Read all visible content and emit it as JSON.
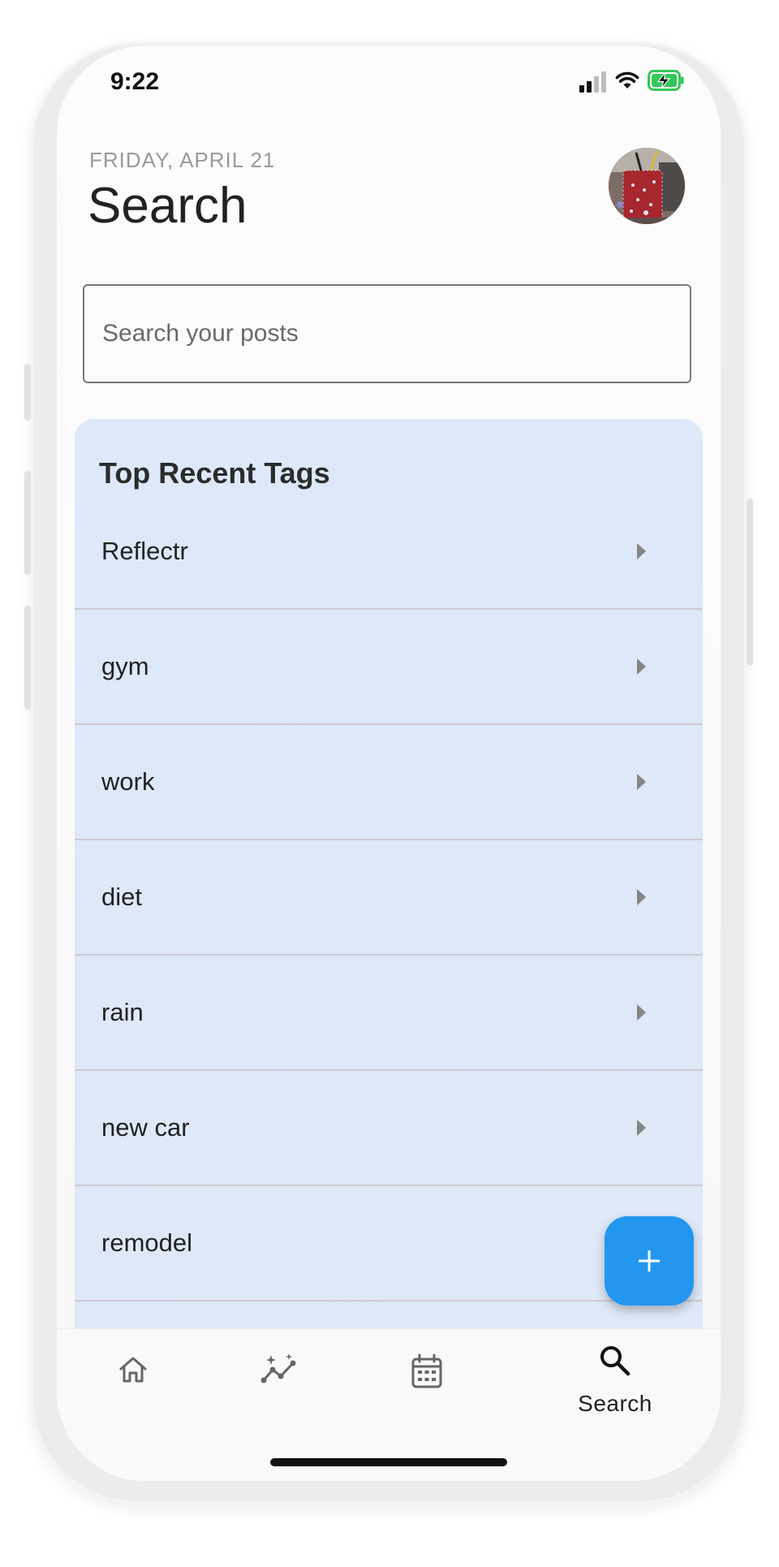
{
  "status_bar": {
    "time": "9:22",
    "signal_icon": "cellular-signal-icon",
    "wifi_icon": "wifi-icon",
    "battery_icon": "battery-charging-icon",
    "battery_color": "#34c759"
  },
  "header": {
    "date": "FRIDAY, APRIL 21",
    "title": "Search",
    "avatar_icon": "user-avatar"
  },
  "search": {
    "placeholder": "Search your posts",
    "value": ""
  },
  "tags": {
    "title": "Top Recent Tags",
    "items": [
      {
        "label": "Reflectr"
      },
      {
        "label": "gym"
      },
      {
        "label": "work"
      },
      {
        "label": "diet"
      },
      {
        "label": "rain"
      },
      {
        "label": "new car"
      },
      {
        "label": "remodel"
      }
    ]
  },
  "fab": {
    "icon": "plus-icon",
    "color": "#2396f0"
  },
  "bottom_nav": {
    "items": [
      {
        "icon": "home-icon",
        "label": ""
      },
      {
        "icon": "insights-icon",
        "label": ""
      },
      {
        "icon": "calendar-icon",
        "label": ""
      },
      {
        "icon": "search-icon",
        "label": "Search",
        "active": true
      }
    ]
  }
}
